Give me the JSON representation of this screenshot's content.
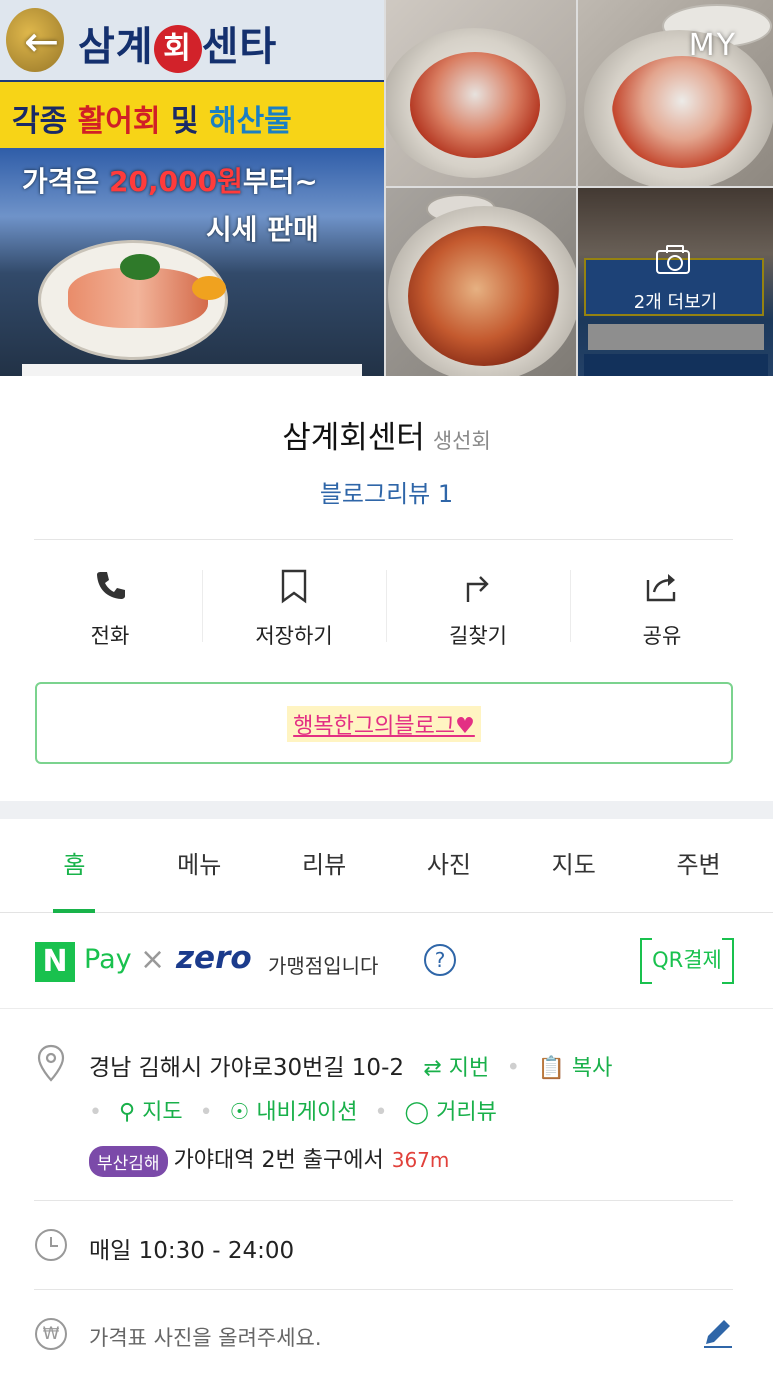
{
  "header": {
    "back_icon": "arrow-left-icon",
    "my_label": "MY",
    "more_photos_label": "2개 더보기",
    "photo_sign": {
      "shop_name_left": "삼계",
      "shop_name_circle": "회",
      "shop_name_right": "센타",
      "line1_prefix": "각종 ",
      "line1_red": "활어회",
      "line1_mid": " 및 ",
      "line1_blue": "해산물",
      "price_prefix": "가격은 ",
      "price_value": "20,000원",
      "price_suffix": "부터~",
      "price_sub": "시세 판매"
    }
  },
  "place": {
    "name": "삼계회센터",
    "category": "생선회",
    "blog_review": "블로그리뷰 1"
  },
  "actions": [
    {
      "label": "전화",
      "icon": "phone-icon"
    },
    {
      "label": "저장하기",
      "icon": "bookmark-icon"
    },
    {
      "label": "길찾기",
      "icon": "directions-icon"
    },
    {
      "label": "공유",
      "icon": "share-icon"
    }
  ],
  "promo": {
    "text": "행복한그의블로그♥"
  },
  "tabs": [
    "홈",
    "메뉴",
    "리뷰",
    "사진",
    "지도",
    "주변"
  ],
  "active_tab": "홈",
  "pay": {
    "npay_letter": "N",
    "pay_word": "Pay",
    "times": "×",
    "zero_word": "zero",
    "description": "가맹점입니다",
    "help_icon": "question-icon",
    "qr_label": "QR결제"
  },
  "address": {
    "text": "경남 김해시 가야로30번길 10-2",
    "lot_link": "⇄ 지번",
    "copy_link": "복사",
    "map_link": "지도",
    "navi_link": "내비게이션",
    "street_link": "거리뷰",
    "line_badge": "부산김해",
    "station": "가야대역 2번 출구에서",
    "distance": "367m"
  },
  "hours": {
    "text": "매일 10:30 - 24:00"
  },
  "price": {
    "won_symbol": "₩",
    "placeholder": "가격표 사진을 올려주세요."
  },
  "colors": {
    "accent_green": "#19b04a",
    "link_blue": "#2f66a8",
    "subway_purple": "#7b4aa9",
    "distance_red": "#e1413b",
    "promo_pink": "#e32f84"
  }
}
